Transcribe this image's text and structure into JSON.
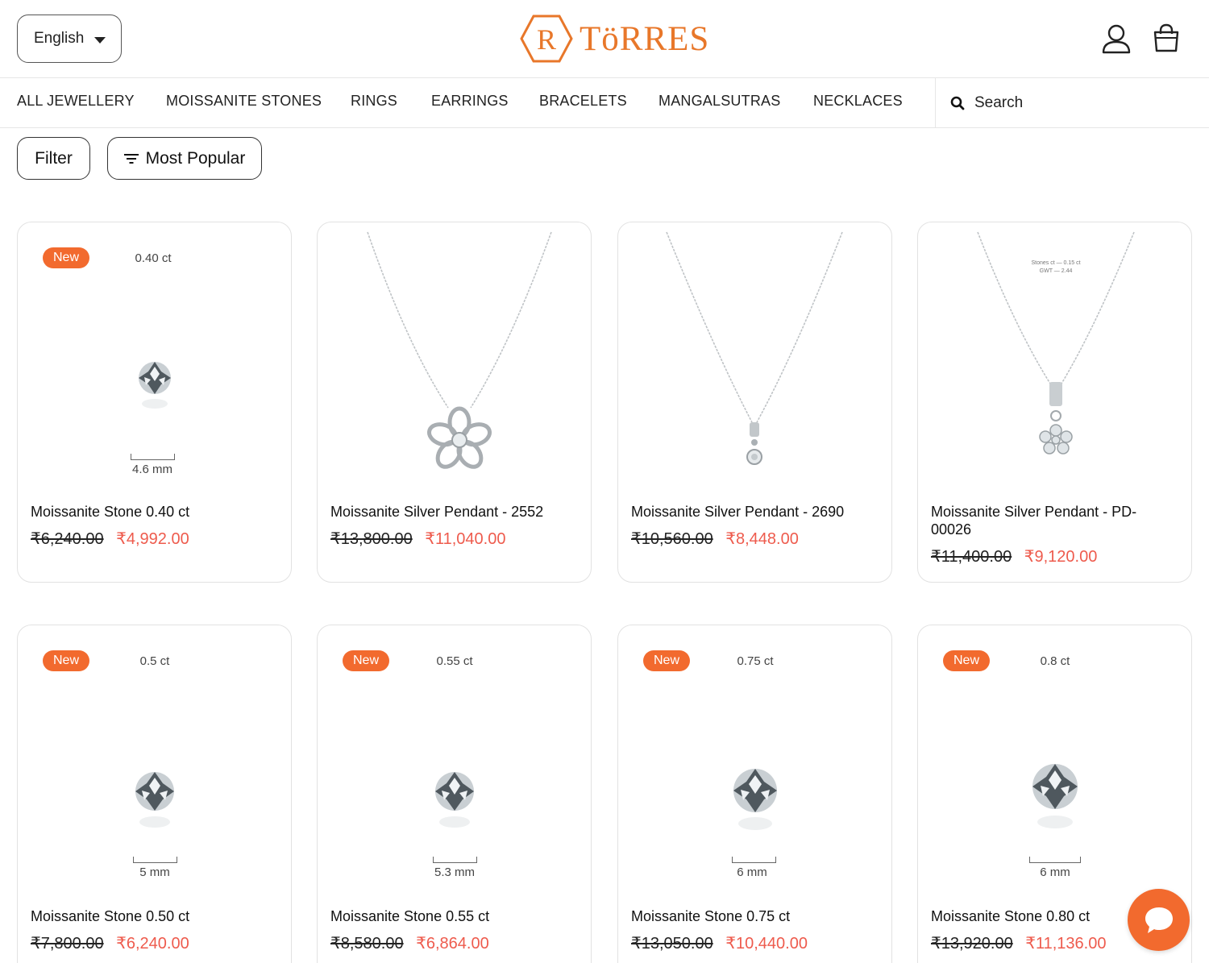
{
  "header": {
    "language": "English",
    "brand": "TöRRES",
    "logo_mark": "R"
  },
  "nav": {
    "items": [
      "ALL JEWELLERY",
      "MOISSANITE STONES",
      "RINGS",
      "EARRINGS",
      "BRACELETS",
      "MANGALSUTRAS",
      "NECKLACES"
    ],
    "search_placeholder": "Search"
  },
  "controls": {
    "filter_label": "Filter",
    "sort_label": "Most Popular"
  },
  "products": [
    {
      "type": "stone",
      "badge": "New",
      "carat": "0.40 ct",
      "size": "4.6 mm",
      "name": "Moissanite Stone 0.40 ct",
      "old_price": "₹6,240.00",
      "price": "₹4,992.00"
    },
    {
      "type": "pendant",
      "name": "Moissanite Silver Pendant - 2552",
      "old_price": "₹13,800.00",
      "price": "₹11,040.00"
    },
    {
      "type": "pendant",
      "name": "Moissanite Silver Pendant - 2690",
      "old_price": "₹10,560.00",
      "price": "₹8,448.00"
    },
    {
      "type": "pendant",
      "name": "Moissanite Silver Pendant - PD-00026",
      "old_price": "₹11,400.00",
      "price": "₹9,120.00",
      "image_note_1": "Stones ct — 0.15 ct",
      "image_note_2": "GWT — 2.44"
    },
    {
      "type": "stone",
      "badge": "New",
      "carat": "0.5 ct",
      "size": "5 mm",
      "name": "Moissanite Stone 0.50 ct",
      "old_price": "₹7,800.00",
      "price": "₹6,240.00"
    },
    {
      "type": "stone",
      "badge": "New",
      "carat": "0.55 ct",
      "size": "5.3 mm",
      "name": "Moissanite Stone 0.55 ct",
      "old_price": "₹8,580.00",
      "price": "₹6,864.00"
    },
    {
      "type": "stone",
      "badge": "New",
      "carat": "0.75 ct",
      "size": "6 mm",
      "name": "Moissanite Stone 0.75 ct",
      "old_price": "₹13,050.00",
      "price": "₹10,440.00"
    },
    {
      "type": "stone",
      "badge": "New",
      "carat": "0.8 ct",
      "size": "6 mm",
      "name": "Moissanite Stone 0.80 ct",
      "old_price": "₹13,920.00",
      "price": "₹11,136.00"
    }
  ],
  "colors": {
    "brand_orange": "#e8772a",
    "badge_orange": "#f26a2e",
    "sale_price_red": "#ee5b4d"
  },
  "icons": [
    "caret-down-icon",
    "user-icon",
    "shopping-bag-icon",
    "search-icon",
    "sort-icon",
    "chat-icon"
  ]
}
